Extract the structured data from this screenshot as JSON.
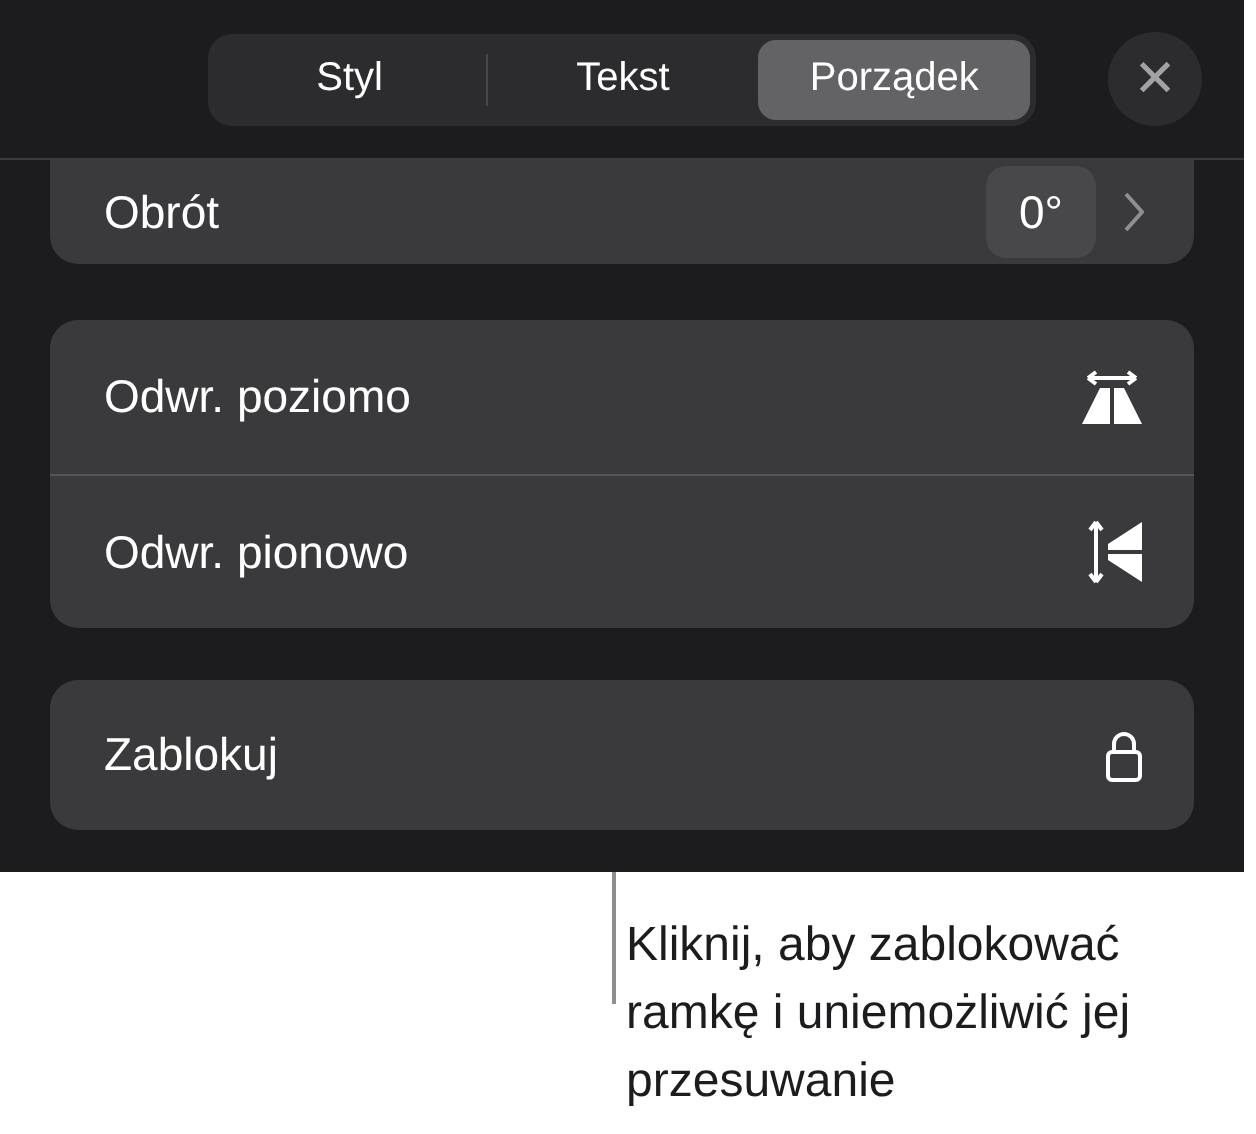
{
  "tabs": [
    {
      "label": "Styl",
      "selected": false
    },
    {
      "label": "Tekst",
      "selected": false
    },
    {
      "label": "Porządek",
      "selected": true
    }
  ],
  "close_button": {
    "label": "✕"
  },
  "rotation": {
    "label": "Obrót",
    "value": "0°"
  },
  "flip_rows": [
    {
      "label": "Odwr. poziomo",
      "kind": "horizontal"
    },
    {
      "label": "Odwr. pionowo",
      "kind": "vertical"
    }
  ],
  "lock_row": {
    "label": "Zablokuj"
  },
  "callout": {
    "text": "Kliknij, aby zablokować ramkę i uniemożliwić jej przesuwanie"
  }
}
